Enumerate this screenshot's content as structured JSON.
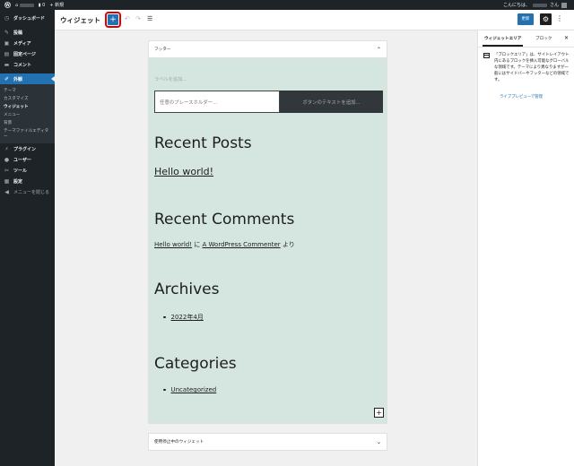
{
  "adminbar": {
    "site_name": "",
    "comments_count": "0",
    "new_label": "新規",
    "greeting_prefix": "こんにちは、",
    "greeting_suffix": "さん"
  },
  "sidebar": {
    "items": [
      {
        "label": "ダッシュボード",
        "icon": "dashboard-icon"
      },
      {
        "label": "投稿",
        "icon": "pin-icon"
      },
      {
        "label": "メディア",
        "icon": "media-icon"
      },
      {
        "label": "固定ページ",
        "icon": "page-icon"
      },
      {
        "label": "コメント",
        "icon": "comment-icon"
      },
      {
        "label": "外観",
        "icon": "appearance-icon"
      },
      {
        "label": "プラグイン",
        "icon": "plugin-icon"
      },
      {
        "label": "ユーザー",
        "icon": "user-icon"
      },
      {
        "label": "ツール",
        "icon": "tools-icon"
      },
      {
        "label": "設定",
        "icon": "settings-icon"
      }
    ],
    "submenu": [
      "テーマ",
      "カスタマイズ",
      "ウィジェット",
      "メニュー",
      "背景",
      "テーマファイルエディター"
    ],
    "collapse_label": "メニューを閉じる"
  },
  "header": {
    "title": "ウィジェット",
    "add_label": "+",
    "update_label": "更新"
  },
  "footer_area": {
    "title": "フッター",
    "search_label": "ラベルを追加...",
    "search_placeholder": "任意のプレースホルダー...",
    "search_button": "ボタンのテキストを追加...",
    "recent_posts_heading": "Recent Posts",
    "recent_post_link": "Hello world!",
    "recent_comments_heading": "Recent Comments",
    "comment_post": "Hello world!",
    "comment_on": "に",
    "comment_author": "A WordPress Commenter",
    "comment_suffix": "より",
    "archives_heading": "Archives",
    "archive_item": "2022年4月",
    "categories_heading": "Categories",
    "category_item": "Uncategorized"
  },
  "inactive_area": {
    "title": "使用停止中のウィジェット"
  },
  "settings": {
    "tab_widget_area": "ウィジェットエリア",
    "tab_block": "ブロック",
    "description": "「ブロックエリア」は、サイトレイアウト内にあるブロックを挿入可能なグローバルな領域です。テーマにより異なりますが一般にはサイドバーやフッターなどの領域です。",
    "preview_link": "ライブプレビューで管理"
  },
  "colors": {
    "accent": "#2271b1",
    "admin_dark": "#1d2327",
    "footer_bg": "#d4e6df",
    "highlight": "#dd0000"
  }
}
